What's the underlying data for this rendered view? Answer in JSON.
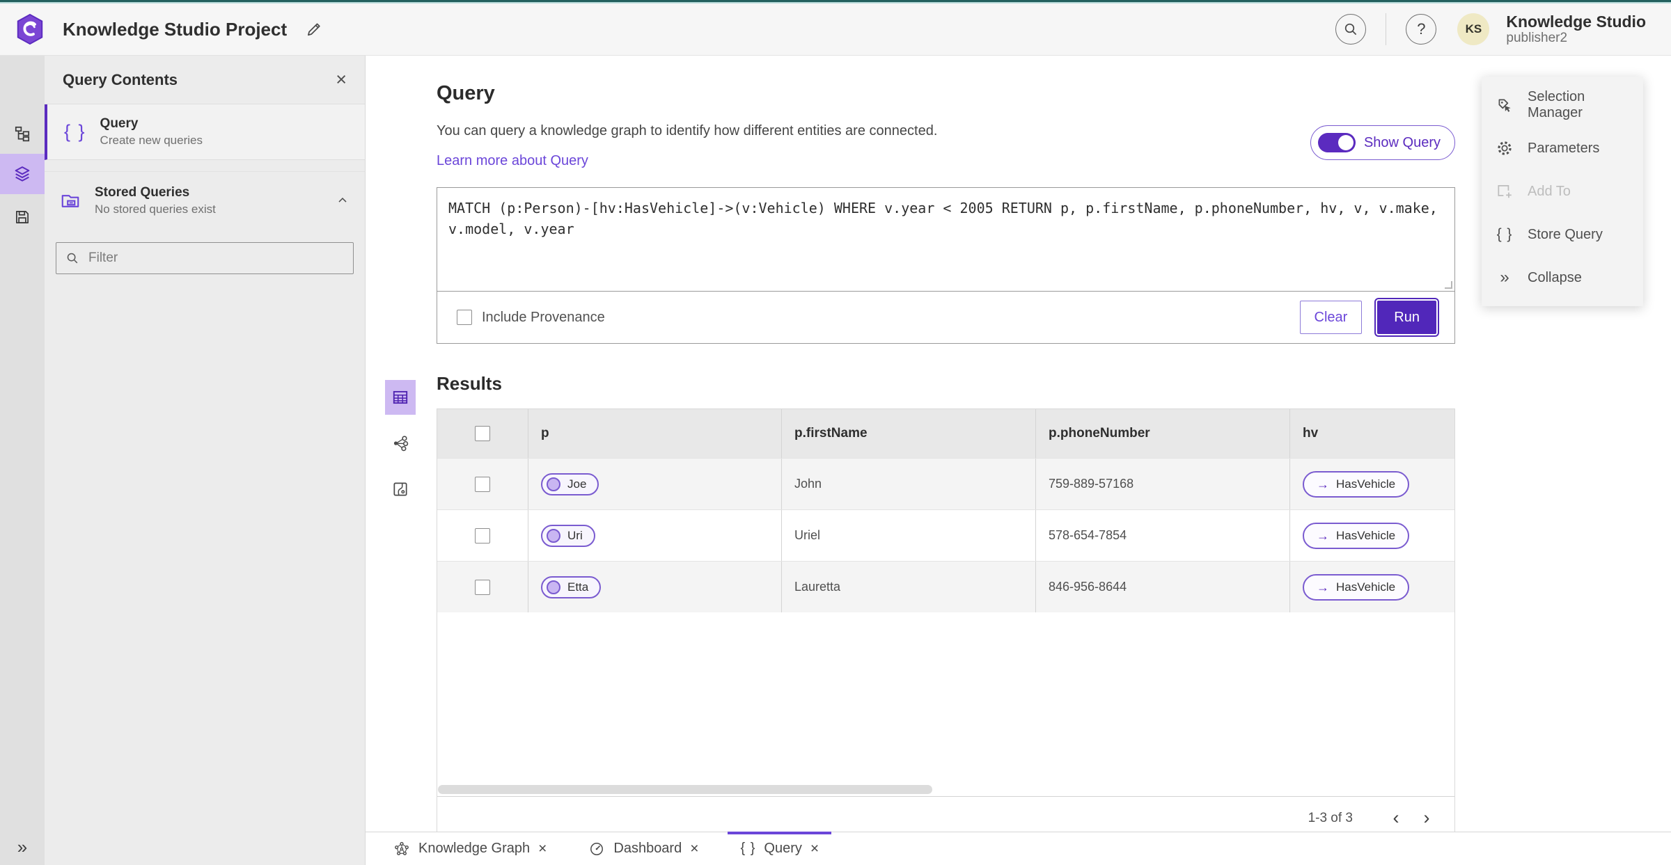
{
  "header": {
    "title": "Knowledge Studio Project",
    "product_name": "Knowledge Studio",
    "user_name": "publisher2",
    "avatar_initials": "KS",
    "help_glyph": "?"
  },
  "rail": {
    "expand_glyph": "»"
  },
  "sidebar_panel": {
    "title": "Query Contents",
    "close_glyph": "×",
    "query_item": {
      "icon_glyph": "{ }",
      "title": "Query",
      "subtitle": "Create new queries"
    },
    "stored_item": {
      "title": "Stored Queries",
      "subtitle": "No stored queries exist"
    },
    "filter_placeholder": "Filter"
  },
  "query_section": {
    "title": "Query",
    "description": "You can query a knowledge graph to identify how different entities are connected.",
    "learn_more_label": "Learn more about Query",
    "show_query_label": "Show Query",
    "query_text": "MATCH (p:Person)-[hv:HasVehicle]->(v:Vehicle) WHERE v.year < 2005 RETURN p, p.firstName, p.phoneNumber, hv, v, v.make, v.model, v.year",
    "include_provenance_label": "Include Provenance",
    "clear_label": "Clear",
    "run_label": "Run"
  },
  "results": {
    "title": "Results",
    "columns": [
      "p",
      "p.firstName",
      "p.phoneNumber",
      "hv"
    ],
    "rows": [
      {
        "entity": "Joe",
        "first_name": "John",
        "phone": "759-889-57168",
        "edge": "HasVehicle"
      },
      {
        "entity": "Uri",
        "first_name": "Uriel",
        "phone": "578-654-7854",
        "edge": "HasVehicle"
      },
      {
        "entity": "Etta",
        "first_name": "Lauretta",
        "phone": "846-956-8644",
        "edge": "HasVehicle"
      }
    ],
    "edge_arrow_glyph": "→",
    "pagination": {
      "label": "1-3 of 3",
      "prev_glyph": "‹",
      "next_glyph": "›"
    }
  },
  "tools_panel": {
    "items": [
      {
        "label": "Selection Manager"
      },
      {
        "label": "Parameters"
      },
      {
        "label": "Add To"
      },
      {
        "label": "Store Query"
      },
      {
        "label": "Collapse"
      }
    ],
    "store_query_glyph": "{ }",
    "collapse_glyph": "»"
  },
  "bottom_tabs": [
    {
      "label": "Knowledge Graph",
      "close_glyph": "×"
    },
    {
      "label": "Dashboard",
      "close_glyph": "×"
    },
    {
      "label": "Query",
      "close_glyph": "×"
    }
  ],
  "colors": {
    "accent_purple": "#5b2bbf",
    "run_button_purple": "#5127ba",
    "active_icon_bg": "#cdb9f2",
    "top_stripe_teal": "#23605e",
    "avatar_bg": "#efe9c4"
  }
}
